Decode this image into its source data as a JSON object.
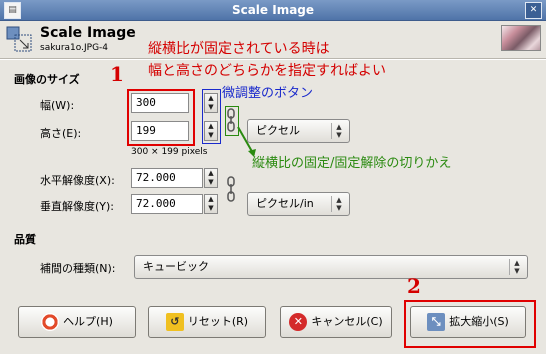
{
  "window": {
    "title": "Scale Image"
  },
  "header": {
    "title": "Scale Image",
    "filename": "sakura1o.JPG-4"
  },
  "image_size": {
    "section_label": "画像のサイズ",
    "width_label": "幅(W):",
    "width_value": "300",
    "height_label": "高さ(E):",
    "height_value": "199",
    "pixel_info": "300 × 199 pixels",
    "unit": "ピクセル",
    "x_res_label": "水平解像度(X):",
    "x_res_value": "72.000",
    "y_res_label": "垂直解像度(Y):",
    "y_res_value": "72.000",
    "res_unit": "ピクセル/in"
  },
  "quality": {
    "section_label": "品質",
    "interp_label": "補間の種類(N):",
    "interp_value": "キュービック"
  },
  "buttons": {
    "help": "ヘルプ(H)",
    "reset": "リセット(R)",
    "cancel": "キャンセル(C)",
    "scale": "拡大縮小(S)"
  },
  "annotations": {
    "note_line1": "縦横比が固定されている時は",
    "note_line2": "幅と高さのどちらかを指定すればよい",
    "marker1": "1",
    "marker2": "2",
    "spin_note": "微調整のボタン",
    "chain_note": "縦横比の固定/固定解除の切りかえ"
  },
  "colors": {
    "annotation_red": "#d40000",
    "annotation_blue": "#1a2acc",
    "annotation_green": "#2a8a10"
  }
}
